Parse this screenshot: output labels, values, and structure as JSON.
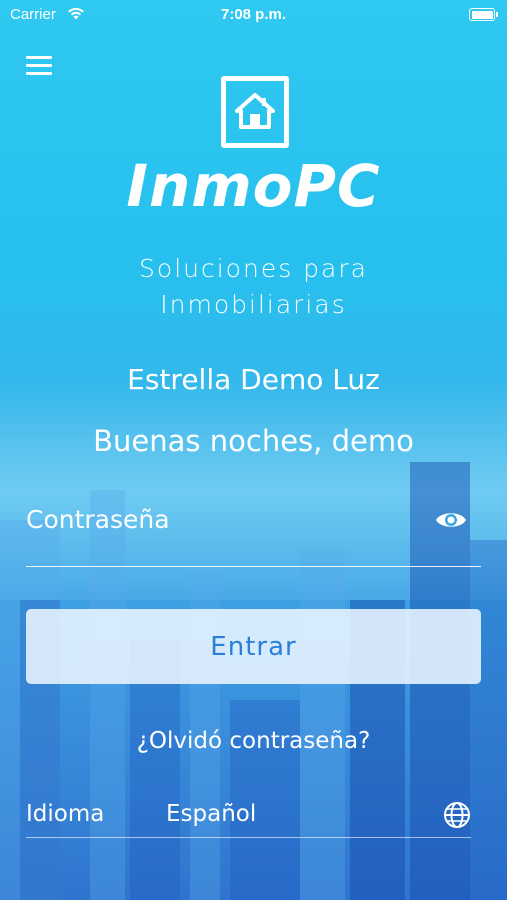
{
  "status_bar": {
    "carrier": "Carrier",
    "time": "7:08 p.m."
  },
  "icons": {
    "menu": "menu-icon",
    "logo": "house-icon",
    "password_toggle": "eye-icon",
    "language": "globe-icon"
  },
  "brand": {
    "name": "InmoPC",
    "tagline_line1": "Soluciones para",
    "tagline_line2": "Inmobiliarias"
  },
  "company": "Estrella Demo Luz",
  "greeting": "Buenas noches, demo",
  "password": {
    "placeholder": "Contraseña"
  },
  "login_button": "Entrar",
  "forgot_password": "¿Olvidó contraseña?",
  "language": {
    "label": "Idioma",
    "value": "Español"
  },
  "colors": {
    "background_top": "#2ec8f0",
    "background_bottom": "#2f74cf",
    "button_text": "#2b7fd6"
  }
}
